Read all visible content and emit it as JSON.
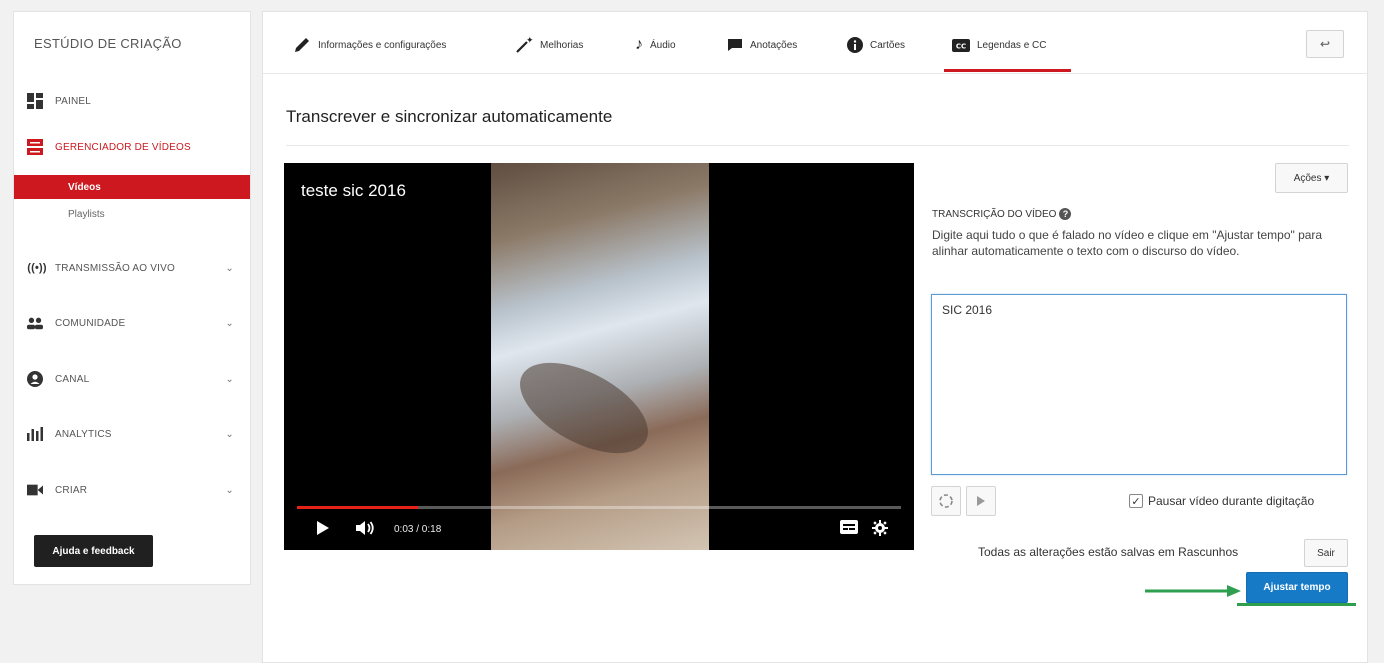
{
  "sidebar": {
    "title": "ESTÚDIO DE CRIAÇÃO",
    "items": [
      {
        "label": "PAINEL",
        "icon": "dashboard-icon"
      },
      {
        "label": "GERENCIADOR DE VÍDEOS",
        "icon": "video-manager-icon"
      },
      {
        "label": "TRANSMISSÃO AO VIVO",
        "icon": "broadcast-icon"
      },
      {
        "label": "COMUNIDADE",
        "icon": "community-icon"
      },
      {
        "label": "CANAL",
        "icon": "channel-icon"
      },
      {
        "label": "ANALYTICS",
        "icon": "analytics-icon"
      },
      {
        "label": "CRIAR",
        "icon": "camera-icon"
      }
    ],
    "sub_items": [
      {
        "label": "Vídeos",
        "active": true
      },
      {
        "label": "Playlists",
        "active": false
      }
    ],
    "help_button": "Ajuda e feedback"
  },
  "tabs": [
    {
      "label": "Informações e configurações",
      "icon": "pencil-icon"
    },
    {
      "label": "Melhorias",
      "icon": "magic-wand-icon"
    },
    {
      "label": "Áudio",
      "icon": "music-note-icon"
    },
    {
      "label": "Anotações",
      "icon": "annotation-icon"
    },
    {
      "label": "Cartões",
      "icon": "info-icon"
    },
    {
      "label": "Legendas e CC",
      "icon": "cc-icon",
      "active": true
    }
  ],
  "back_button": "↩",
  "page_title": "Transcrever e sincronizar automaticamente",
  "player": {
    "video_title": "teste sic 2016",
    "time": "0:03 / 0:18",
    "progress": 0.2
  },
  "actions_button": "Ações ▾",
  "transcript": {
    "label": "TRANSCRIÇÃO DO VÍDEO",
    "description": "Digite aqui tudo o que é falado no vídeo e clique em \"Ajustar tempo\" para alinhar automaticamente o texto com o discurso do vídeo.",
    "text": "SIC 2016"
  },
  "pause_checkbox": {
    "label": "Pausar vídeo durante digitação",
    "checked": true
  },
  "status_text": "Todas as alterações estão salvas em Rascunhos",
  "exit_button": "Sair",
  "adjust_button": "Ajustar tempo",
  "colors": {
    "accent_red": "#cc181e",
    "primary_blue": "#167ac6",
    "annotation_green": "#2e9e4f"
  }
}
